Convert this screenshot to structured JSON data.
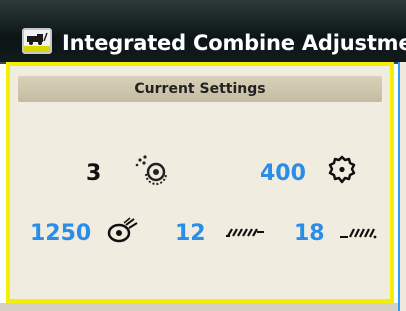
{
  "window": {
    "title": "Integrated Combine Adjustment"
  },
  "current_settings": {
    "header": "Current Settings",
    "rows": [
      [
        {
          "value": "3",
          "icon": "concave-clearance-icon",
          "color": "#111111"
        },
        {
          "value": "400",
          "icon": "fan-speed-icon",
          "color": "#2a8ee8"
        }
      ],
      [
        {
          "value": "1250",
          "icon": "rotor-speed-icon",
          "color": "#2a8ee8"
        },
        {
          "value": "12",
          "icon": "chaffer-icon",
          "color": "#2a8ee8"
        },
        {
          "value": "18",
          "icon": "sieve-icon",
          "color": "#2a8ee8"
        }
      ]
    ]
  },
  "colors": {
    "highlight_border": "#f3ee06",
    "value_blue": "#2a8ee8",
    "title_bar": "#0c1616"
  }
}
